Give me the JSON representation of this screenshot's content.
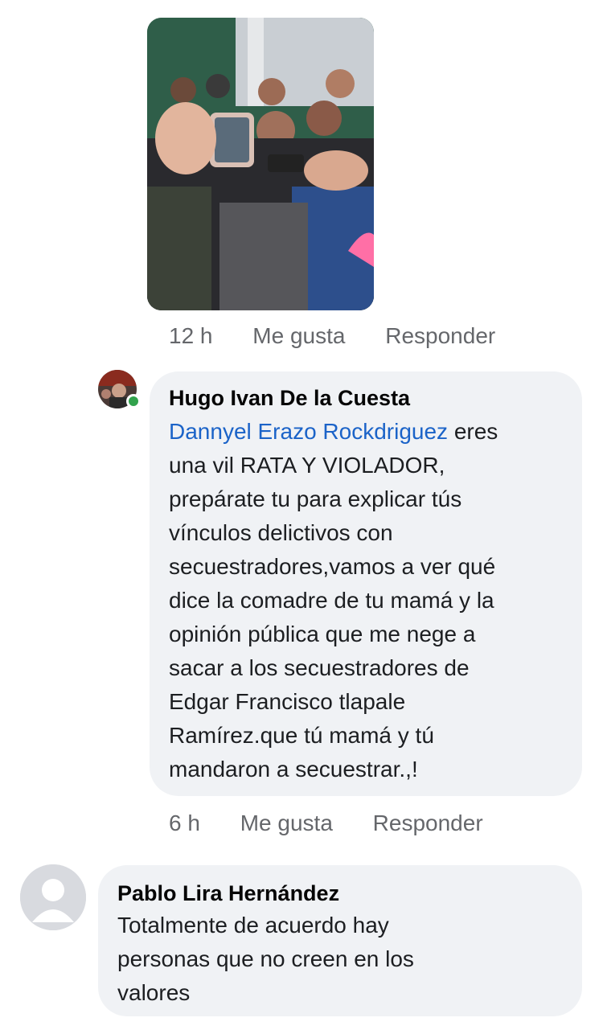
{
  "comment1": {
    "time": "12 h",
    "like_label": "Me gusta",
    "reply_label": "Responder"
  },
  "comment2": {
    "author": "Hugo Ivan De la Cuesta",
    "mention": "Dannyel Erazo Rockdriguez",
    "text_after_mention": " eres\nuna vil RATA Y VIOLADOR,\nprepárate tu para explicar tús\nvínculos delictivos con\nsecuestradores,vamos a ver qué\ndice la comadre de tu mamá y la\nopinión pública que me nege a\nsacar a los secuestradores de\nEdgar Francisco tlapale\nRamírez.que tú mamá y tú\nmandaron a secuestrar.,!",
    "time": "6 h",
    "like_label": "Me gusta",
    "reply_label": "Responder"
  },
  "comment3": {
    "author": "Pablo Lira Hernández",
    "text": "Totalmente  de acuerdo  hay\npersonas  que no creen en los\nvalores"
  },
  "colors": {
    "bubble": "#f0f2f5",
    "mention": "#1b63c8",
    "meta": "#65676b",
    "online": "#31a24c"
  }
}
